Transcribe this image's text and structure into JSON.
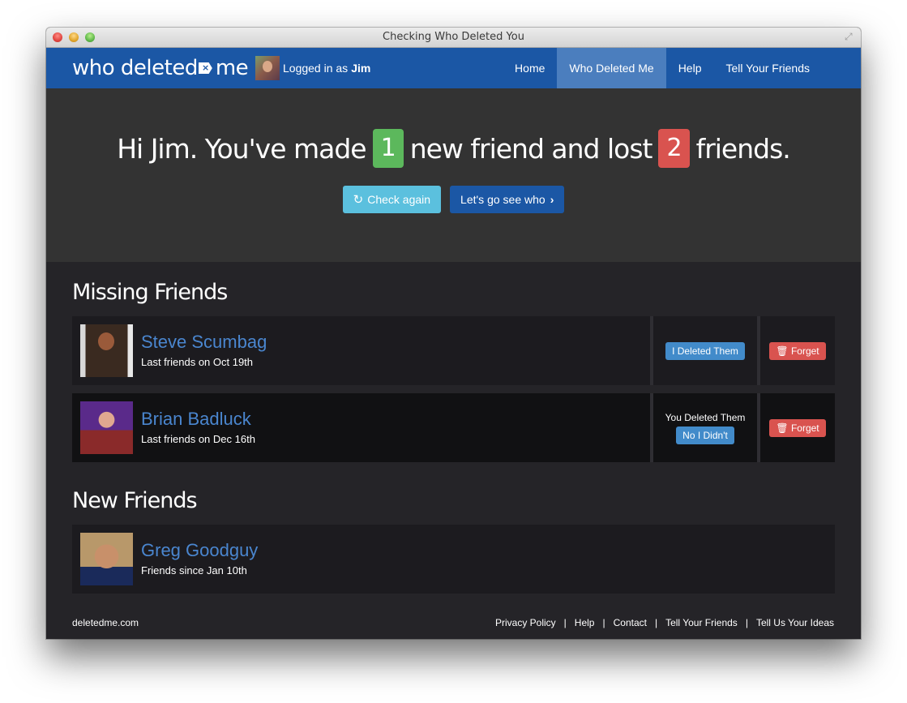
{
  "window": {
    "title": "Checking Who Deleted You"
  },
  "navbar": {
    "logo": {
      "part1": "who deleted",
      "tag_glyph": "×",
      "part2": "me"
    },
    "user": {
      "prefix": "Logged in as",
      "name": "Jim"
    },
    "nav_items": [
      {
        "label": "Home",
        "active": false
      },
      {
        "label": "Who Deleted Me",
        "active": true
      },
      {
        "label": "Help",
        "active": false
      },
      {
        "label": "Tell Your Friends",
        "active": false
      }
    ]
  },
  "hero": {
    "text1": "Hi Jim. You've made",
    "new_count": "1",
    "text2": "new friend and lost",
    "lost_count": "2",
    "text3": "friends.",
    "check_again_label": "Check again",
    "see_who_label": "Let's go see who"
  },
  "missing": {
    "title": "Missing Friends",
    "friends": [
      {
        "name": "Steve Scumbag",
        "subtitle": "Last friends on Oct 19th",
        "status_label": "",
        "action_label": "I Deleted Them",
        "forget_label": "Forget"
      },
      {
        "name": "Brian Badluck",
        "subtitle": "Last friends on Dec 16th",
        "status_label": "You Deleted Them",
        "action_label": "No I Didn't",
        "forget_label": "Forget"
      }
    ]
  },
  "new_friends": {
    "title": "New Friends",
    "friends": [
      {
        "name": "Greg Goodguy",
        "subtitle": "Friends since Jan 10th"
      }
    ]
  },
  "footer": {
    "site": "deletedme.com",
    "links": [
      "Privacy Policy",
      "Help",
      "Contact",
      "Tell Your Friends",
      "Tell Us Your Ideas"
    ],
    "divider": "|"
  },
  "colors": {
    "brand_blue": "#1b57a5",
    "nav_active": "#4b7ebe",
    "success": "#5cb85c",
    "danger": "#d9534f",
    "info": "#5bc0de",
    "link": "#4a86cf"
  }
}
